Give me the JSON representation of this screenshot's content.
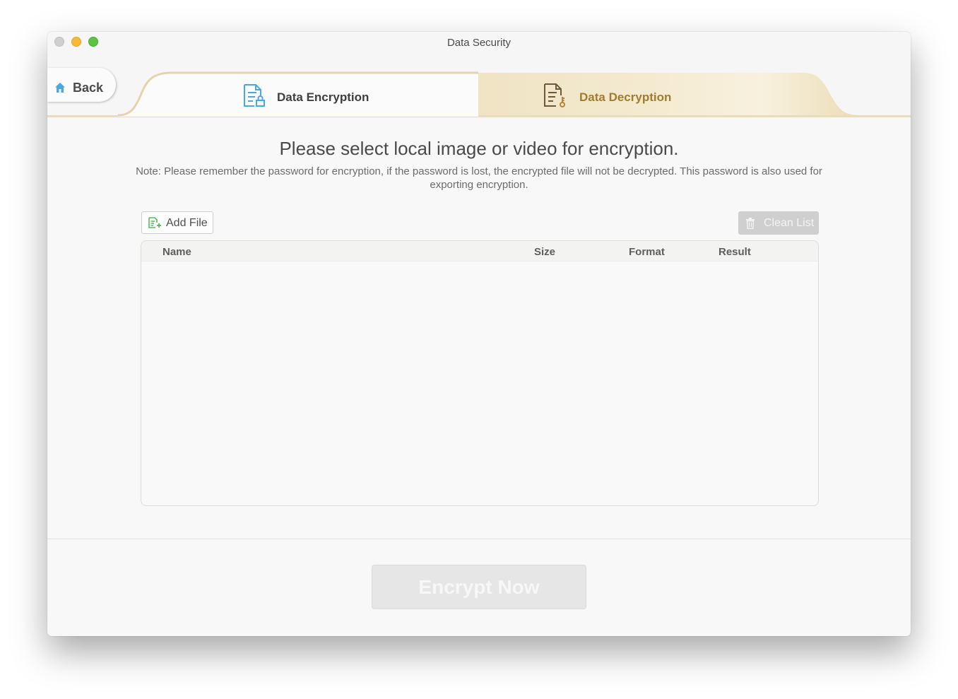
{
  "window": {
    "title": "Data Security"
  },
  "nav": {
    "back_label": "Back"
  },
  "tabs": [
    {
      "label": "Data Encryption",
      "selected": true,
      "icon": "document-lock-icon"
    },
    {
      "label": "Data Decryption",
      "selected": false,
      "icon": "document-key-icon"
    }
  ],
  "main": {
    "heading": "Please select local image or video for encryption.",
    "note": "Note: Please remember the password for encryption, if the password is lost, the encrypted file will not be decrypted. This password is also used for exporting encryption."
  },
  "toolbar": {
    "add_file_label": "Add File",
    "clean_list_label": "Clean List"
  },
  "table": {
    "columns": [
      "Name",
      "Size",
      "Format",
      "Result"
    ],
    "rows": []
  },
  "footer": {
    "encrypt_label": "Encrypt Now"
  },
  "colors": {
    "accent_blue": "#4aa8dc",
    "gold": "#a17b2e",
    "green": "#5cb85c"
  }
}
